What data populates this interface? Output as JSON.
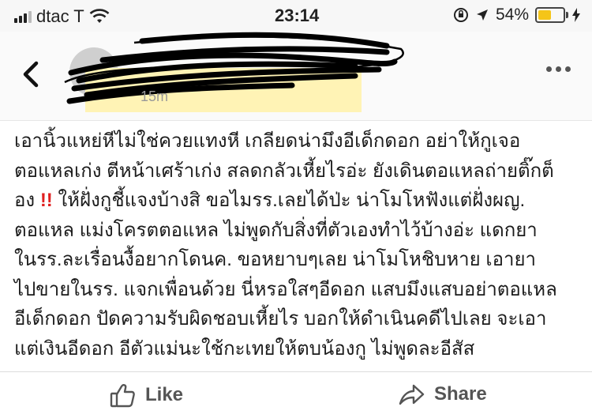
{
  "status_bar": {
    "carrier": "dtac T",
    "time": "23:14",
    "battery_percent": "54%",
    "battery_level": 0.54,
    "icons": [
      "signal-icon",
      "wifi-icon",
      "orientation-lock-icon",
      "location-arrow-icon",
      "battery-icon",
      "charging-bolt-icon"
    ]
  },
  "header": {
    "timestamp": "15m",
    "icons": [
      "back-chevron-icon",
      "more-options-icon"
    ]
  },
  "post": {
    "lines": [
      "เอานิ้วแหย่หีไม่ใช่ควยแทงหี เกลียดน่ามึงอีเด็กดอก อย่าให้กูเจอ",
      "ตอแหลเก่ง ตีหน้าเศร้าเก่ง สลดกลัวเหี้ยไรอ่ะ ยังเดินตอแหลถ่ายติ๊กต็",
      "อง",
      "ตอแหล แม่งโครตตอแหล ไม่พูดกับสิ่งที่ตัวเองทำไว้บ้างอ่ะ แดกยา",
      "ในรร.ละเรื่อนงื้อยากโดนค. ขอหยาบๆเลย น่าโมโหชิบหาย เอายา",
      "ไปขายในรร. แจกเพื่อนด้วย นี่หรอใสๆอีดอก แสบมึงแสบอย่าตอแหล",
      "อีเด็กดอก ปัดความรับผิดชอบเหี้ยไร บอกให้ดำเนินคดีไปเลย จะเอา",
      "แต่เงินอีดอก อีตัวแม่นะใช้กะเทยให้ตบน้องกู ไม่พูดละอีสัส"
    ],
    "line3_emphasis": "!!",
    "line3_rest": " ให้ฝั่งกูชี้แจงบ้างสิ ขอไมรร.เลยได้ป่ะ น่าโมโหฟังแต่ฝั่งผญ."
  },
  "actions": {
    "like_label": "Like",
    "share_label": "Share"
  },
  "colors": {
    "emphasis": "#e02020",
    "name_highlight": "#fff3b5",
    "battery": "#f5c518"
  }
}
